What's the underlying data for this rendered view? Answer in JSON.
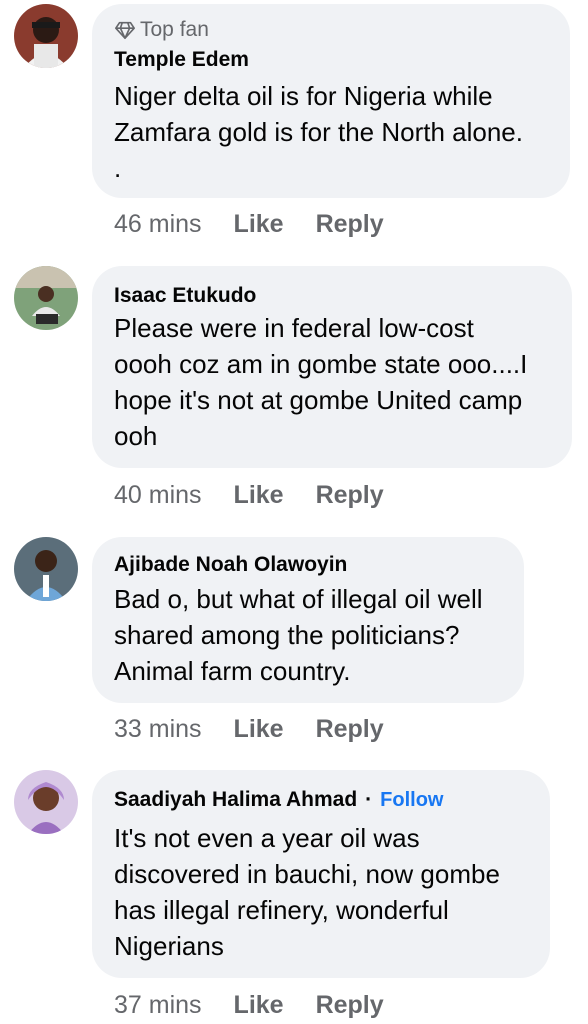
{
  "comments": [
    {
      "badge": "Top fan",
      "name": "Temple Edem",
      "text": "Niger delta oil is for Nigeria while\nZamfara gold is for the North alone.\n.",
      "time": "46 mins",
      "like": "Like",
      "reply": "Reply"
    },
    {
      "name": "Isaac Etukudo",
      "text": "Please were in federal low-cost\noooh coz am in gombe state ooo....I\nhope it's not at gombe United camp\nooh",
      "time": "40 mins",
      "like": "Like",
      "reply": "Reply"
    },
    {
      "name": "Ajibade Noah Olawoyin",
      "text": "Bad o, but what of illegal oil well\nshared among the politicians?\nAnimal farm country.",
      "time": "33 mins",
      "like": "Like",
      "reply": "Reply"
    },
    {
      "name": "Saadiyah Halima Ahmad",
      "separator": "·",
      "follow": "Follow",
      "text": "It's not even a year oil was\ndiscovered in bauchi,  now gombe\nhas illegal refinery,  wonderful\nNigerians",
      "time": "37 mins",
      "like": "Like",
      "reply": "Reply"
    }
  ],
  "colors": {
    "bubble": "#f0f2f5",
    "meta": "#65676b",
    "follow": "#1877f2"
  },
  "icons": {
    "badge": "diamond-icon"
  }
}
